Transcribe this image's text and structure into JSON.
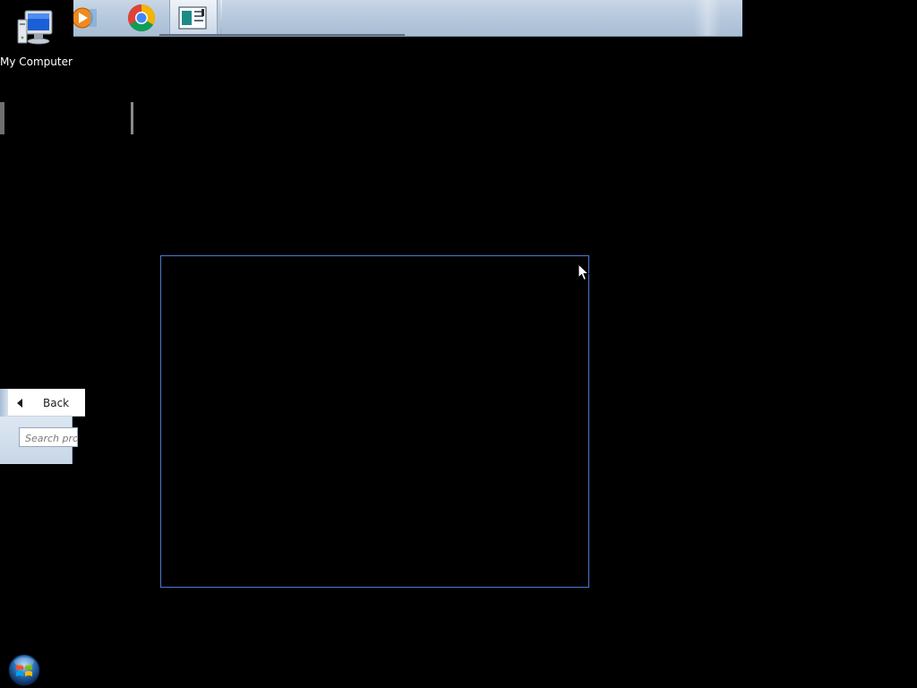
{
  "desktop": {
    "icons": [
      {
        "label": "My Computer",
        "icon": "computer-icon"
      }
    ],
    "background_color": "#000000"
  },
  "taskbar": {
    "items": [
      {
        "name": "media-player",
        "icon": "media-player-icon"
      },
      {
        "name": "chrome",
        "icon": "chrome-icon"
      },
      {
        "name": "active-window",
        "icon": "window-app-icon",
        "active": true
      }
    ],
    "color": "#b6c8dc"
  },
  "start_menu": {
    "back_label": "Back",
    "search_placeholder": "Search pro"
  },
  "selection": {
    "border_color": "#4b7bd0"
  },
  "start_button": {
    "icon": "windows-logo-icon"
  }
}
